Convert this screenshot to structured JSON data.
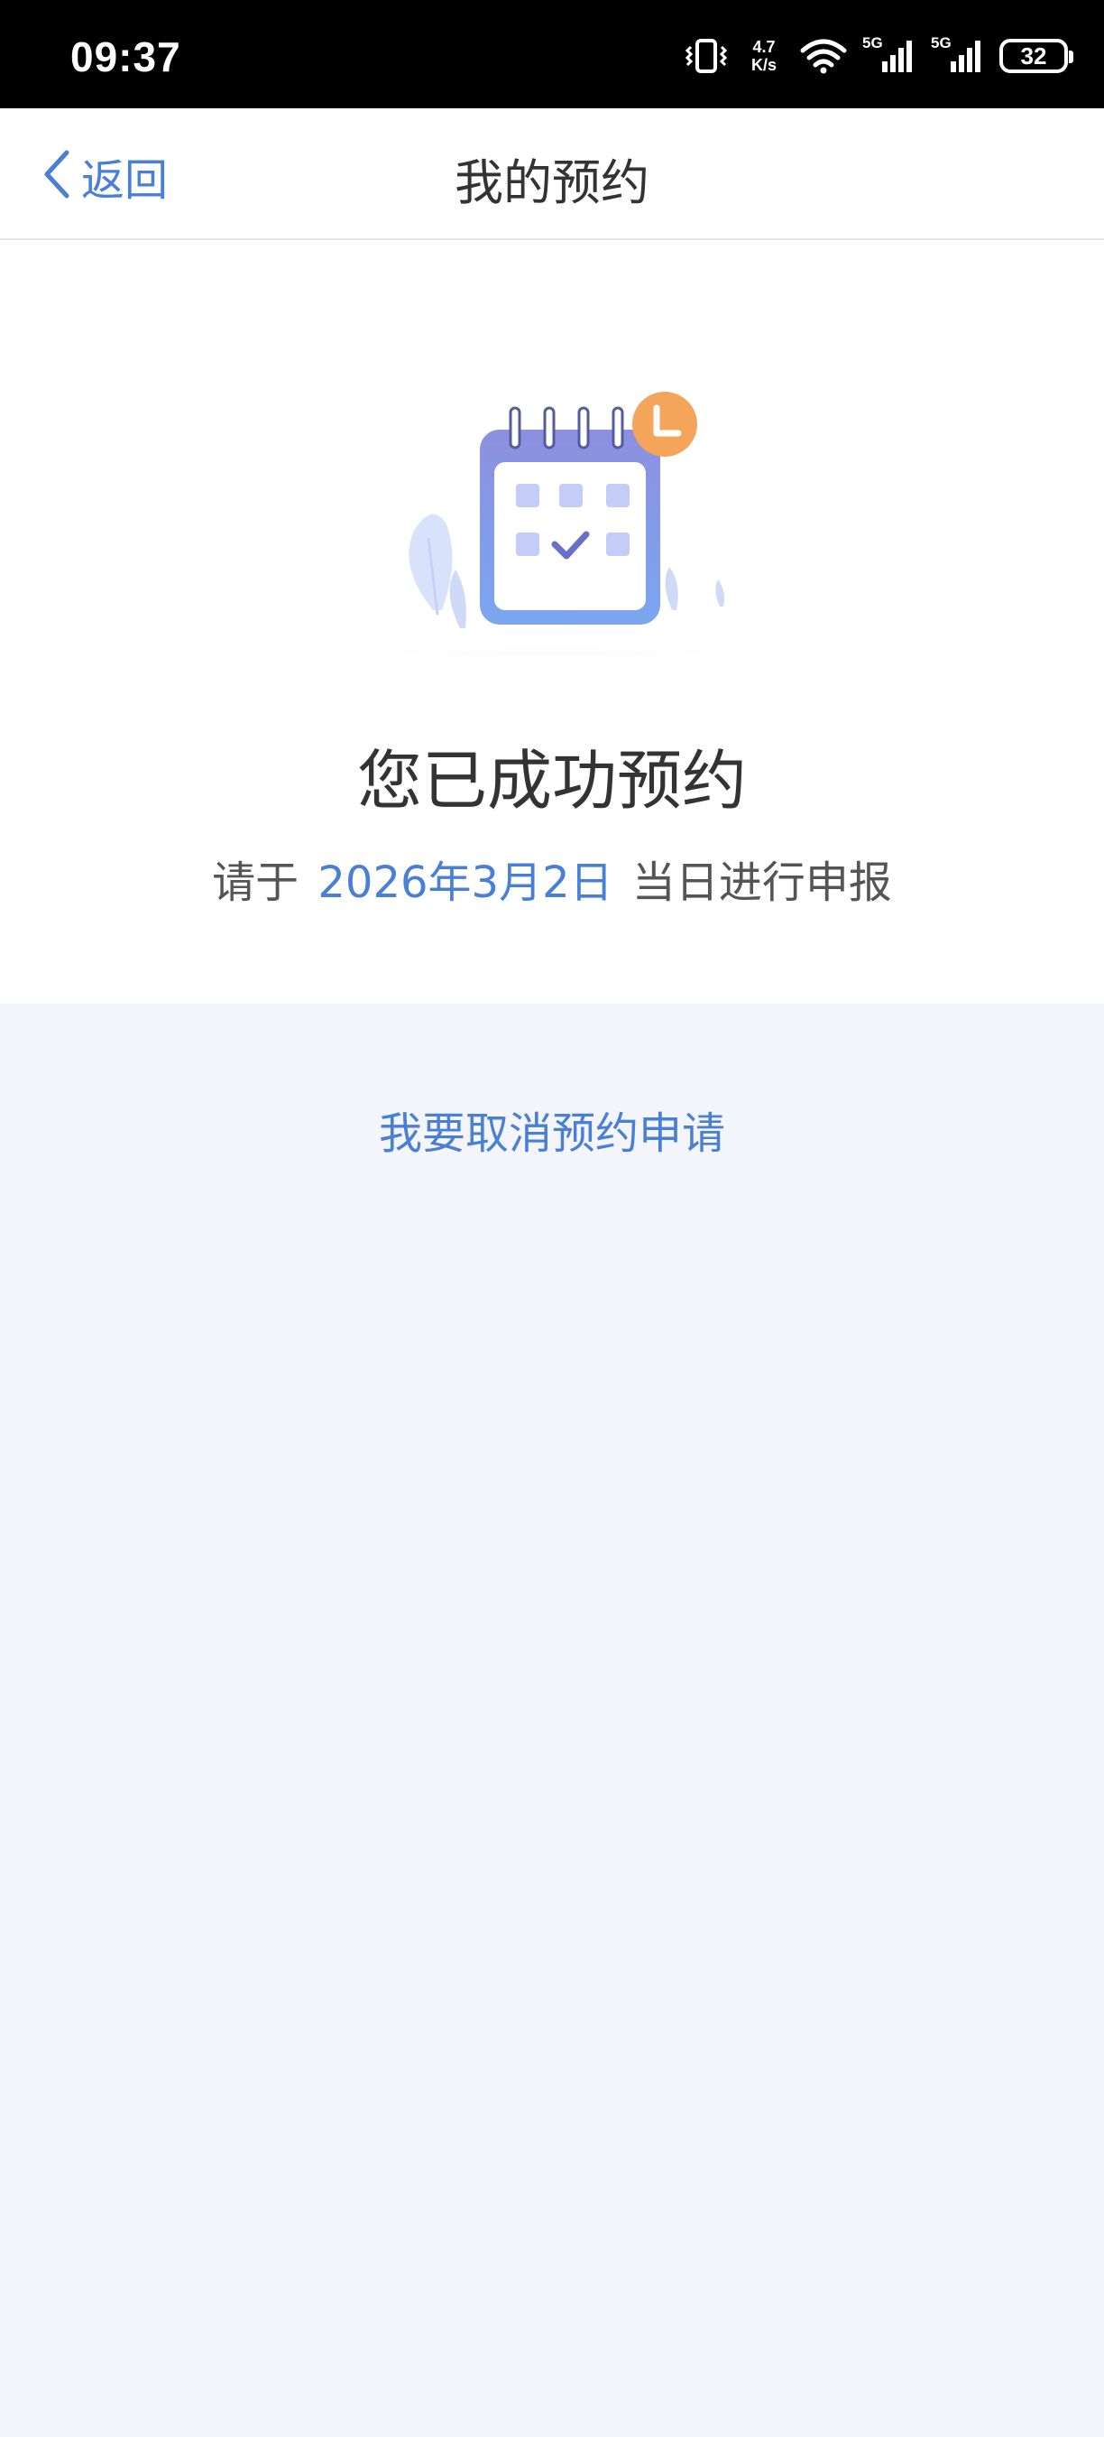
{
  "status_bar": {
    "time": "09:37",
    "net_speed_value": "4.7",
    "net_speed_unit": "K/s",
    "signal_1_label": "5G",
    "signal_2_label": "5G",
    "battery": "32",
    "icons": [
      "vibrate-icon",
      "wifi-icon",
      "signal-icon",
      "signal-icon",
      "battery-icon"
    ]
  },
  "nav": {
    "back_label": "返回",
    "title": "我的预约"
  },
  "success": {
    "title": "您已成功预约",
    "desc_prefix": "请于",
    "date": "2026年3月2日",
    "desc_suffix": "当日进行申报"
  },
  "actions": {
    "cancel_label": "我要取消预约申请"
  },
  "colors": {
    "accent": "#4a7fd6",
    "background": "#f3f5fa",
    "clock_badge": "#f4a55a",
    "calendar": "#7f92e6"
  }
}
